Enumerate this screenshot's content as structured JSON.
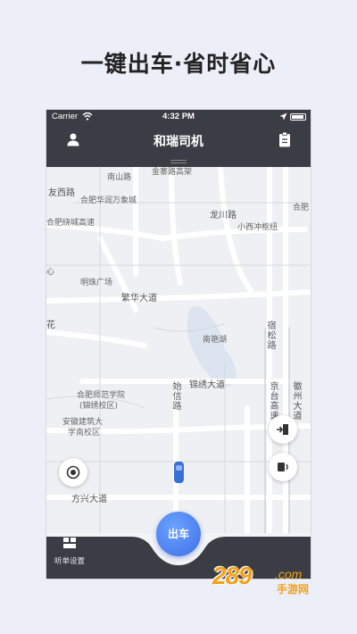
{
  "headline": "一键出车·省时省心",
  "status_bar": {
    "carrier": "Carrier",
    "time": "4:32 PM"
  },
  "nav": {
    "title": "和瑞司机"
  },
  "map_labels": {
    "l1": "南山路",
    "l2": "金寨路高架",
    "l3": "友西路",
    "l4": "合肥华润万象城",
    "l5": "龙川路",
    "l6": "合肥",
    "l7": "合肥绕城高速",
    "l8": "小西冲枢纽",
    "l9": "明珠广场",
    "l10": "繁华大道",
    "l11": "心",
    "l12": "花",
    "l13": "南艳湖",
    "l14": "宿松路",
    "l15": "合肥师范学院",
    "l16": "(锦绣校区)",
    "l17": "始信路",
    "l18": "锦绣大道",
    "l19": "京台高速",
    "l20": "徽州大道",
    "l21": "安徽建筑大",
    "l22": "学南校区",
    "l23": "方兴大道"
  },
  "bottom": {
    "listen_label": "听单设置",
    "go_label": "出车"
  },
  "watermark": {
    "num": "289",
    "com": ".com",
    "cn": "手游网"
  },
  "colors": {
    "bar": "#3b3d44",
    "accent": "#4a7ff0",
    "brand_watermark": "#f2a21a"
  }
}
